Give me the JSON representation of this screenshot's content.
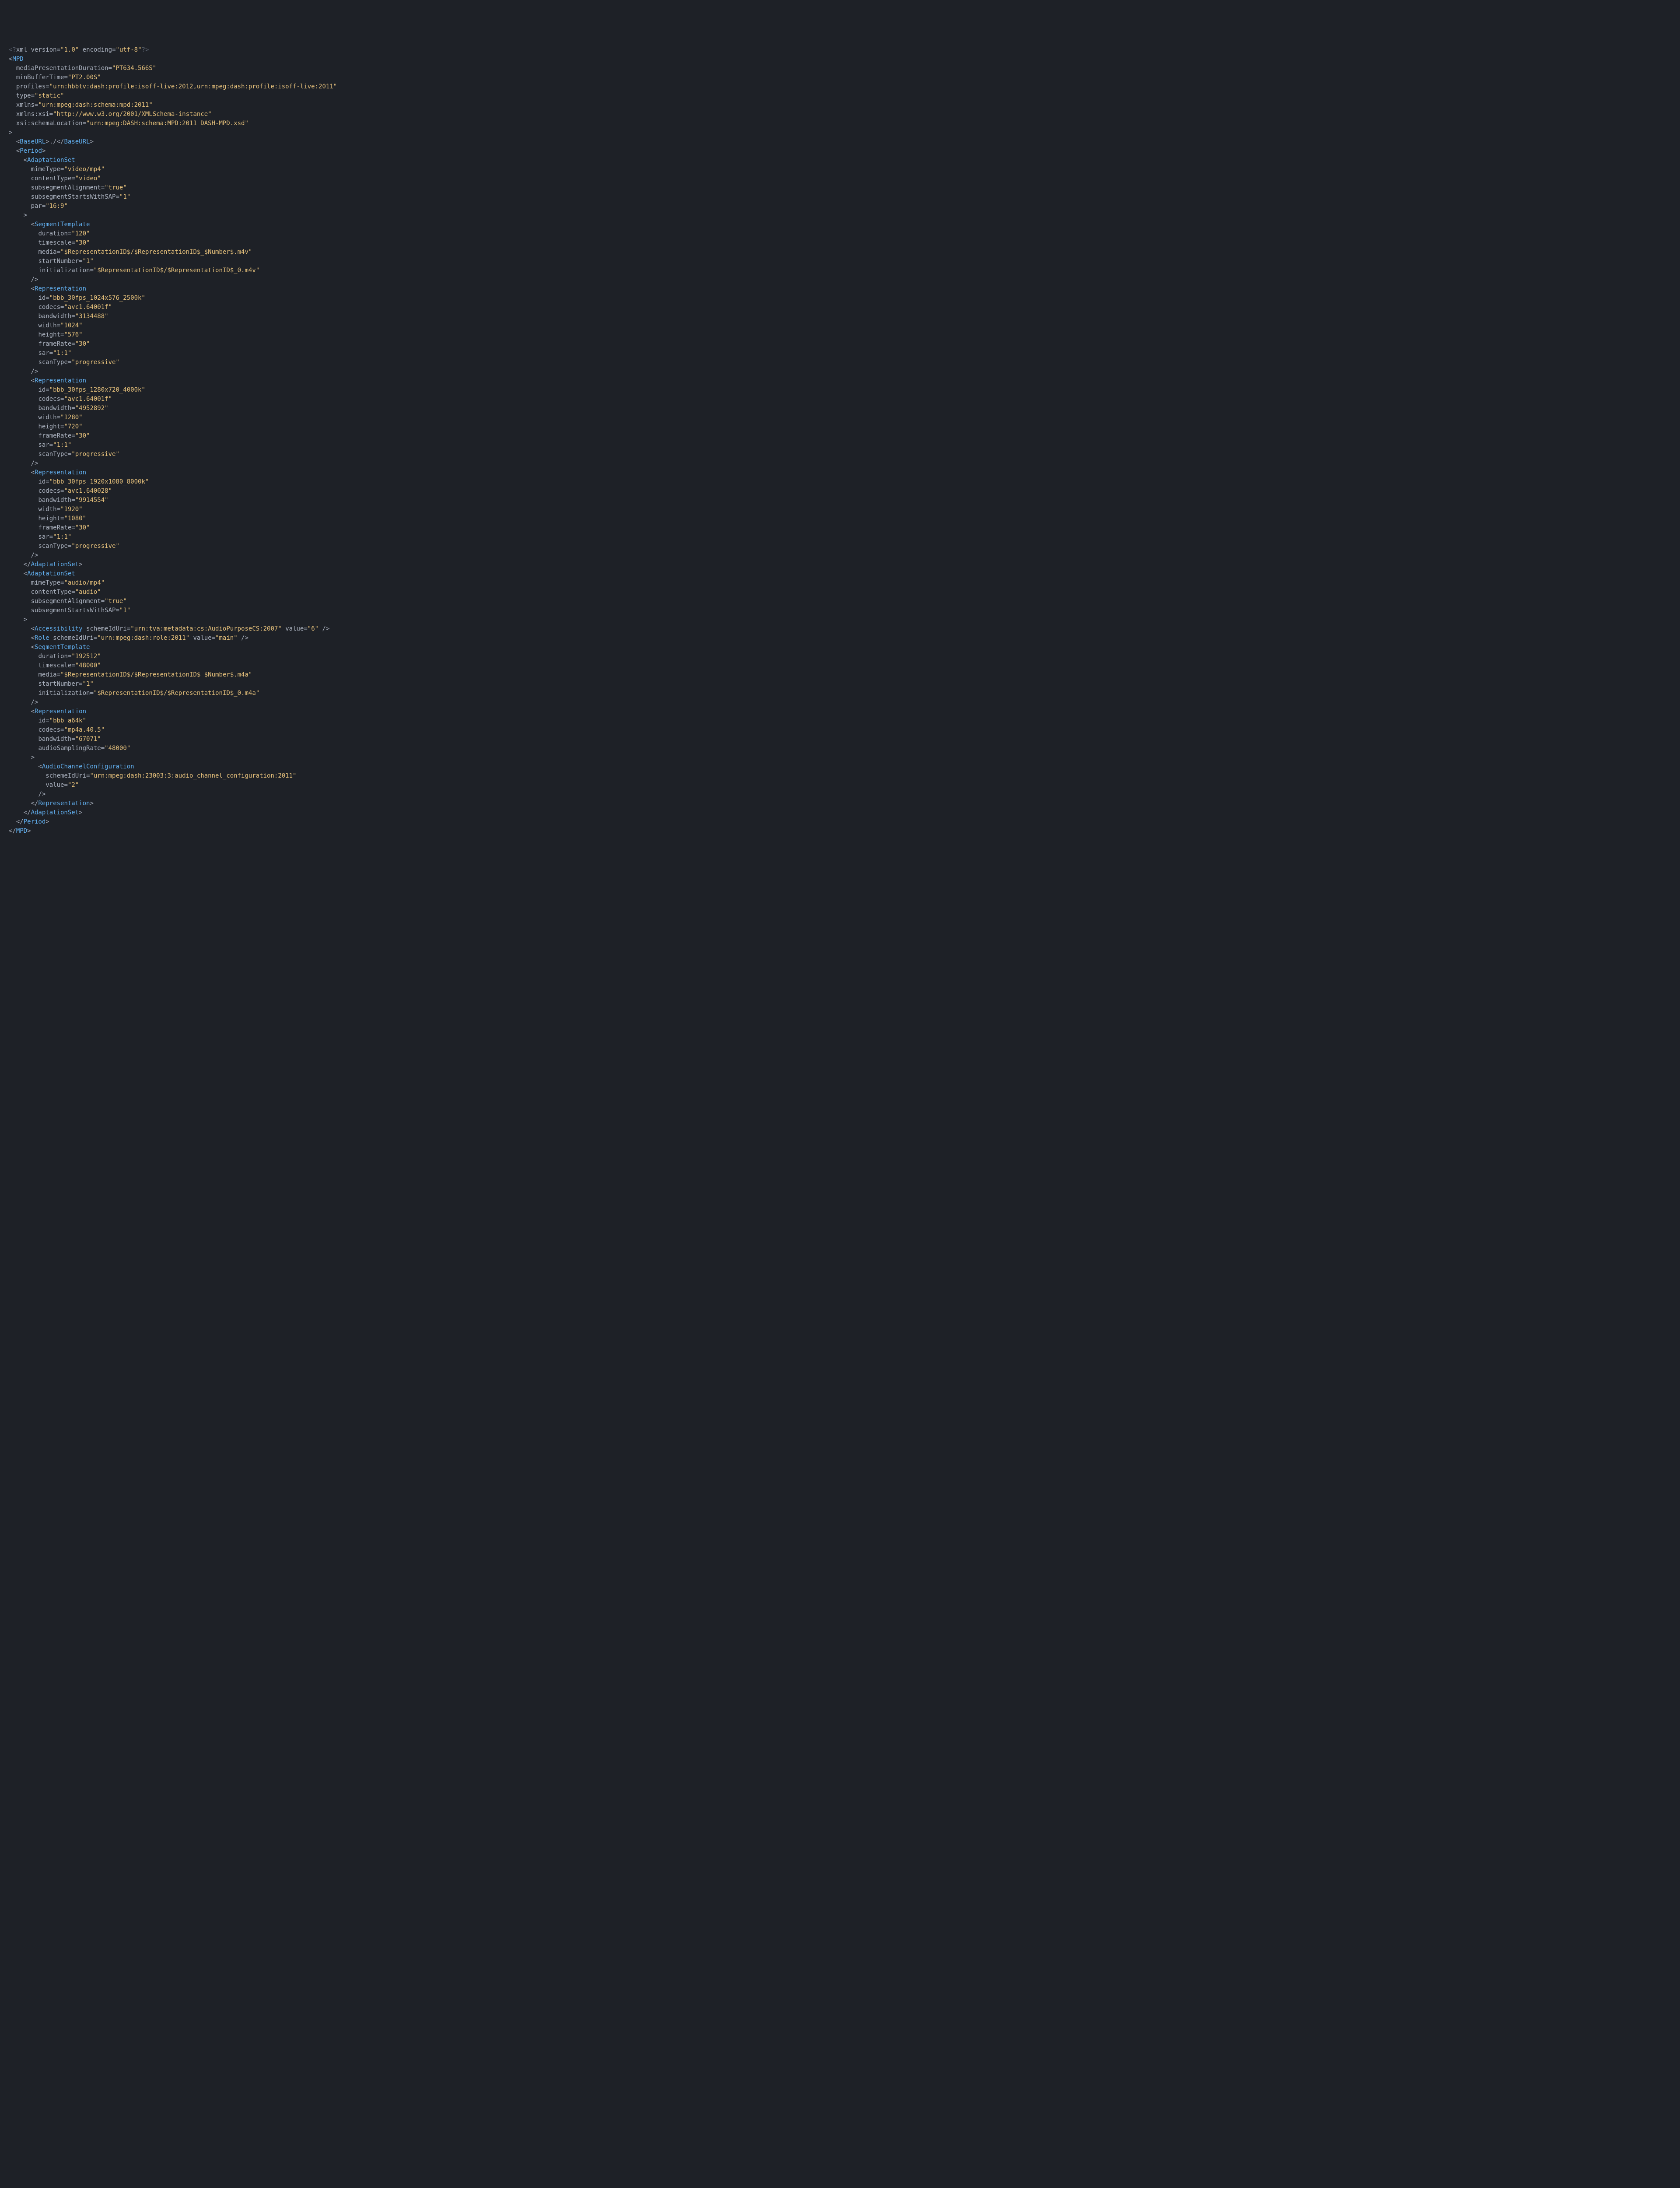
{
  "xml_declaration": {
    "version": "1.0",
    "encoding": "utf-8"
  },
  "mpd": {
    "mediaPresentationDuration": "PT634.566S",
    "minBufferTime": "PT2.00S",
    "profiles": "urn:hbbtv:dash:profile:isoff-live:2012,urn:mpeg:dash:profile:isoff-live:2011",
    "type": "static",
    "xmlns": "urn:mpeg:dash:schema:mpd:2011",
    "xmlns_xsi": "http://www.w3.org/2001/XMLSchema-instance",
    "xsi_schemaLocation": "urn:mpeg:DASH:schema:MPD:2011 DASH-MPD.xsd",
    "baseURL": "./",
    "period": {
      "adaptationSets": [
        {
          "mimeType": "video/mp4",
          "contentType": "video",
          "subsegmentAlignment": "true",
          "subsegmentStartsWithSAP": "1",
          "par": "16:9",
          "segmentTemplate": {
            "duration": "120",
            "timescale": "30",
            "media": "$RepresentationID$/$RepresentationID$_$Number$.m4v",
            "startNumber": "1",
            "initialization": "$RepresentationID$/$RepresentationID$_0.m4v"
          },
          "representations": [
            {
              "id": "bbb_30fps_1024x576_2500k",
              "codecs": "avc1.64001f",
              "bandwidth": "3134488",
              "width": "1024",
              "height": "576",
              "frameRate": "30",
              "sar": "1:1",
              "scanType": "progressive"
            },
            {
              "id": "bbb_30fps_1280x720_4000k",
              "codecs": "avc1.64001f",
              "bandwidth": "4952892",
              "width": "1280",
              "height": "720",
              "frameRate": "30",
              "sar": "1:1",
              "scanType": "progressive"
            },
            {
              "id": "bbb_30fps_1920x1080_8000k",
              "codecs": "avc1.640028",
              "bandwidth": "9914554",
              "width": "1920",
              "height": "1080",
              "frameRate": "30",
              "sar": "1:1",
              "scanType": "progressive"
            }
          ]
        },
        {
          "mimeType": "audio/mp4",
          "contentType": "audio",
          "subsegmentAlignment": "true",
          "subsegmentStartsWithSAP": "1",
          "accessibility": {
            "schemeIdUri": "urn:tva:metadata:cs:AudioPurposeCS:2007",
            "value": "6"
          },
          "role": {
            "schemeIdUri": "urn:mpeg:dash:role:2011",
            "value": "main"
          },
          "segmentTemplate": {
            "duration": "192512",
            "timescale": "48000",
            "media": "$RepresentationID$/$RepresentationID$_$Number$.m4a",
            "startNumber": "1",
            "initialization": "$RepresentationID$/$RepresentationID$_0.m4a"
          },
          "representation": {
            "id": "bbb_a64k",
            "codecs": "mp4a.40.5",
            "bandwidth": "67071",
            "audioSamplingRate": "48000",
            "audioChannelConfiguration": {
              "schemeIdUri": "urn:mpeg:dash:23003:3:audio_channel_configuration:2011",
              "value": "2"
            }
          }
        }
      ]
    }
  }
}
